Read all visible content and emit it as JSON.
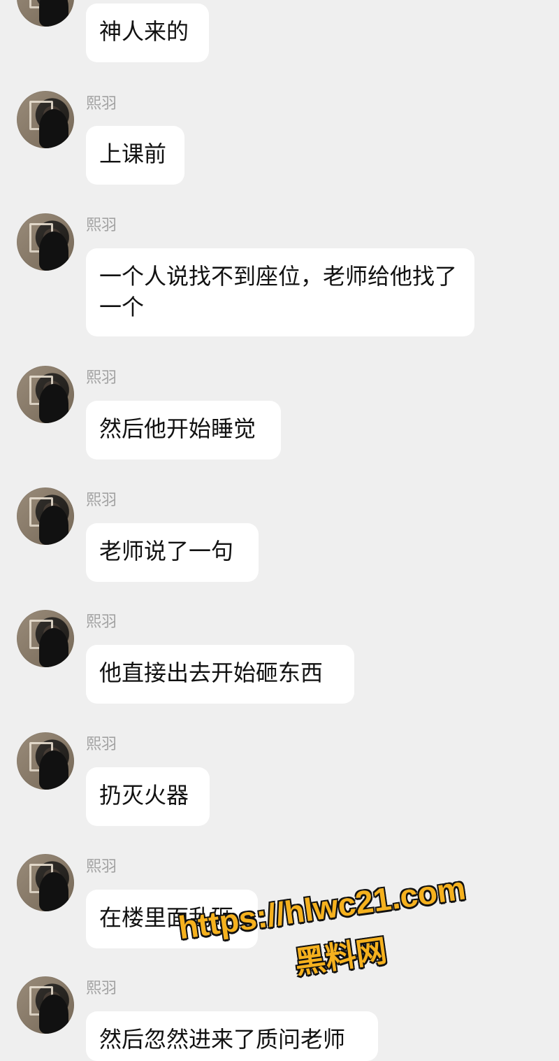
{
  "chat": {
    "messages": [
      {
        "sender": "",
        "text": "神人来的"
      },
      {
        "sender": "熙羽",
        "text": "上课前"
      },
      {
        "sender": "熙羽",
        "text": "一个人说找不到座位，老师给他找了一个"
      },
      {
        "sender": "熙羽",
        "text": "然后他开始睡觉"
      },
      {
        "sender": "熙羽",
        "text": "老师说了一句"
      },
      {
        "sender": "熙羽",
        "text": "他直接出去开始砸东西"
      },
      {
        "sender": "熙羽",
        "text": "扔灭火器"
      },
      {
        "sender": "熙羽",
        "text": "在楼里面乱砸"
      },
      {
        "sender": "熙羽",
        "text": "然后忽然进来了质问老师"
      }
    ]
  },
  "watermark": {
    "url": "https://hlwc21.com",
    "name": "黑料网"
  }
}
